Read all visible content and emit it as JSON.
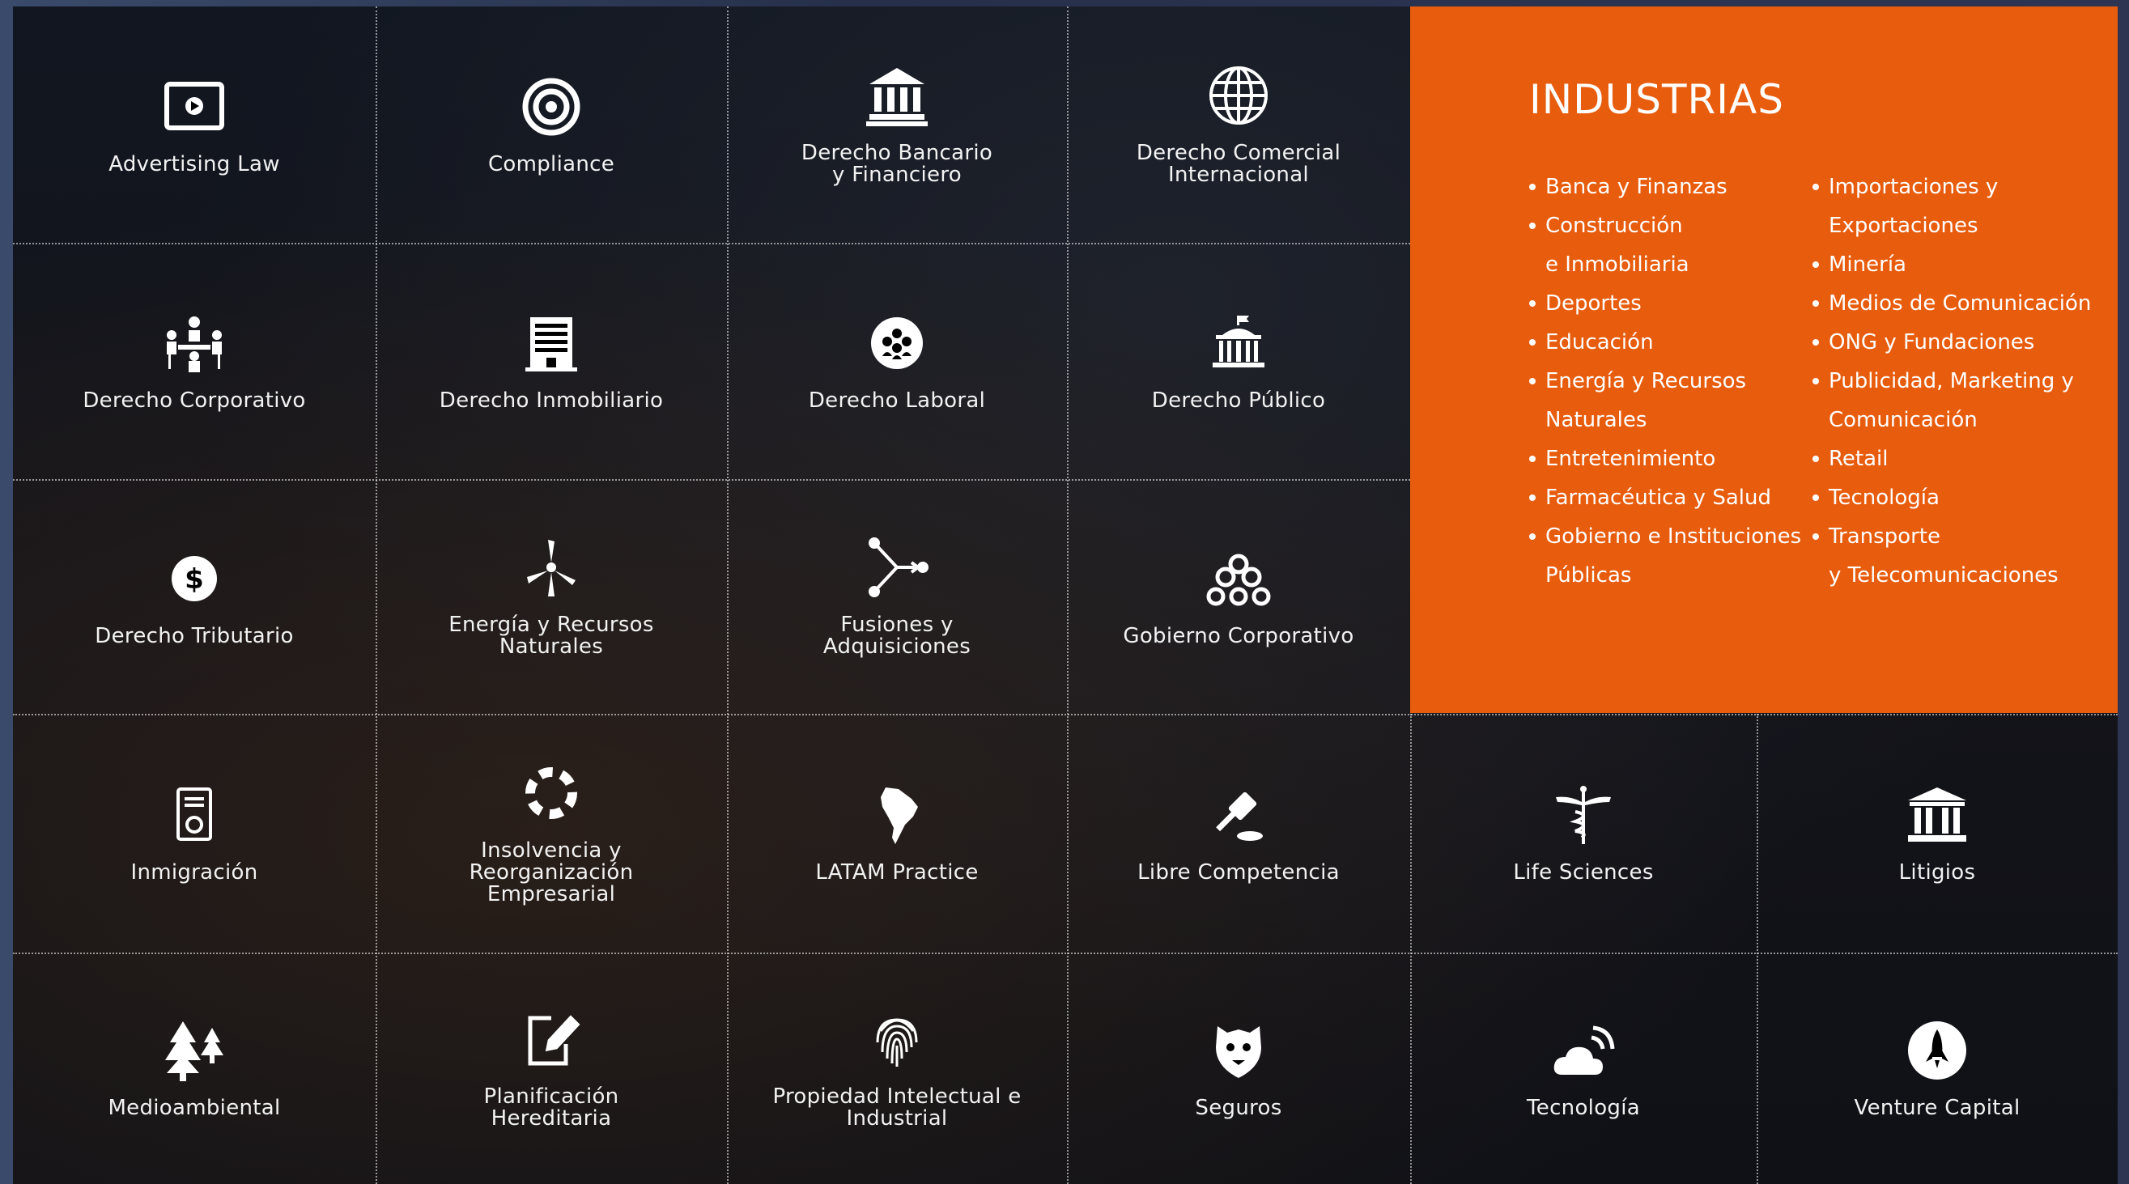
{
  "practice_areas": [
    {
      "label": "Advertising Law",
      "icon": "video-screen-icon"
    },
    {
      "label": "Compliance",
      "icon": "target-icon"
    },
    {
      "label": "Derecho Bancario\ny Financiero",
      "icon": "bank-icon"
    },
    {
      "label": "Derecho Comercial\nInternacional",
      "icon": "globe-icon"
    },
    {
      "label": "Derecho Corporativo",
      "icon": "meeting-people-icon"
    },
    {
      "label": "Derecho Inmobiliario",
      "icon": "building-icon"
    },
    {
      "label": "Derecho Laboral",
      "icon": "group-circle-icon"
    },
    {
      "label": "Derecho Público",
      "icon": "capitol-building-icon"
    },
    {
      "label": "Derecho Tributario",
      "icon": "dollar-coin-icon"
    },
    {
      "label": "Energía y Recursos\nNaturales",
      "icon": "wind-turbine-icon"
    },
    {
      "label": "Fusiones y\nAdquisiciones",
      "icon": "merge-arrows-icon"
    },
    {
      "label": "Gobierno Corporativo",
      "icon": "org-chart-icon"
    },
    {
      "label": "Inmigración",
      "icon": "passport-icon"
    },
    {
      "label": "Insolvencia y\nReorganización\nEmpresarial",
      "icon": "lifebuoy-icon"
    },
    {
      "label": "LATAM Practice",
      "icon": "south-america-icon"
    },
    {
      "label": "Libre Competencia",
      "icon": "gavel-icon"
    },
    {
      "label": "Life Sciences",
      "icon": "caduceus-icon"
    },
    {
      "label": "Litigios",
      "icon": "courthouse-icon"
    },
    {
      "label": "Medioambiental",
      "icon": "trees-icon"
    },
    {
      "label": "Planificación\nHereditaria",
      "icon": "edit-document-icon"
    },
    {
      "label": "Propiedad Intelectual e\nIndustrial",
      "icon": "fingerprint-icon"
    },
    {
      "label": "Seguros",
      "icon": "shield-animal-icon"
    },
    {
      "label": "Tecnología",
      "icon": "cloud-signal-icon"
    },
    {
      "label": "Venture Capital",
      "icon": "rocket-icon"
    }
  ],
  "industries": {
    "title": "INDUSTRIAS",
    "accent_color": "#e85c0d",
    "column_1": [
      "Banca y Finanzas",
      "Construcción\ne Inmobiliaria",
      "Deportes",
      "Educación",
      "Energía y Recursos\nNaturales",
      "Entretenimiento",
      "Farmacéutica y Salud",
      "Gobierno e Instituciones\nPúblicas"
    ],
    "column_2": [
      "Importaciones y\nExportaciones",
      "Minería",
      "Medios de Comunicación",
      "ONG y Fundaciones",
      "Publicidad, Marketing y\nComunicación",
      "Retail",
      "Tecnología",
      "Transporte\ny Telecomunicaciones"
    ]
  }
}
